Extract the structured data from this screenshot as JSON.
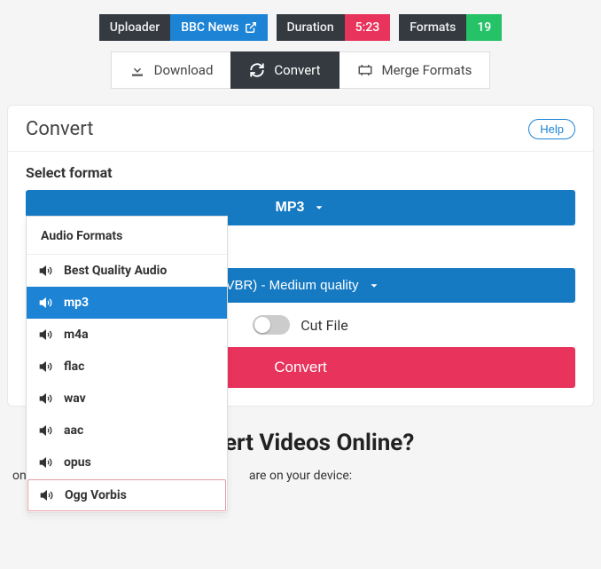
{
  "badges": {
    "uploader_label": "Uploader",
    "uploader_value": "BBC News",
    "duration_label": "Duration",
    "duration_value": "5:23",
    "formats_label": "Formats",
    "formats_value": "19"
  },
  "tabs": {
    "download": "Download",
    "convert": "Convert",
    "merge": "Merge Formats"
  },
  "card": {
    "title": "Convert",
    "help": "Help",
    "select_format_label": "Select format",
    "format_selected": "MP3",
    "quality_selected": "(VBR) - Medium quality",
    "cut_file_label": "Cut File",
    "convert_btn": "Convert"
  },
  "dropdown": {
    "header": "Audio Formats",
    "items": [
      "Best Quality Audio",
      "mp3",
      "m4a",
      "flac",
      "wav",
      "aac",
      "opus",
      "Ogg Vorbis"
    ],
    "selected_index": 1,
    "highlight_index": 7
  },
  "page": {
    "headline": "onvert Videos Online?",
    "subline": "are on your device:",
    "subline_prefix": "on"
  }
}
